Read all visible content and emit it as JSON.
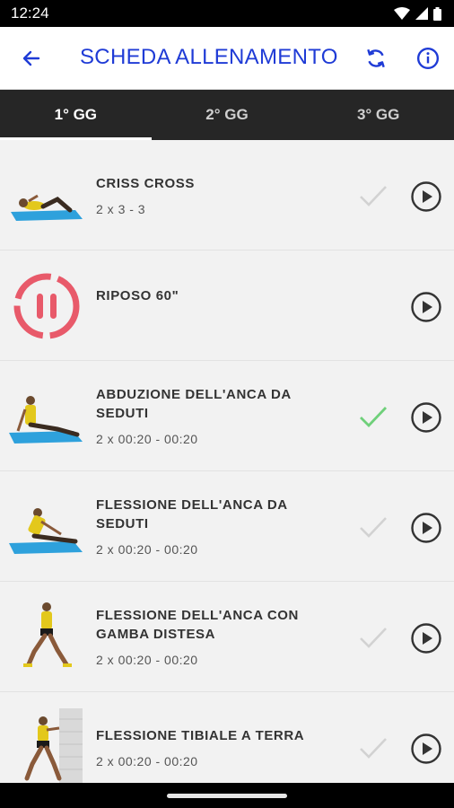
{
  "status": {
    "time": "12:24"
  },
  "header": {
    "title": "SCHEDA ALLENAMENTO",
    "accent": "#1f3bd6"
  },
  "tabs": [
    {
      "label": "1° GG",
      "active": true
    },
    {
      "label": "2° GG",
      "active": false
    },
    {
      "label": "3° GG",
      "active": false
    }
  ],
  "exercises": [
    {
      "name": "CRISS CROSS",
      "detail": "2 x 3 - 3",
      "done": false
    },
    {
      "name": "RIPOSO 60\"",
      "detail": "",
      "done": null
    },
    {
      "name": "ABDUZIONE DELL'ANCA DA SEDUTI",
      "detail": "2 x 00:20 - 00:20",
      "done": true
    },
    {
      "name": "FLESSIONE DELL'ANCA DA SEDUTI",
      "detail": "2 x 00:20 - 00:20",
      "done": false
    },
    {
      "name": "FLESSIONE DELL'ANCA CON GAMBA DISTESA",
      "detail": "2 x 00:20 - 00:20",
      "done": false
    },
    {
      "name": "FLESSIONE TIBIALE A TERRA",
      "detail": "2 x 00:20 - 00:20",
      "done": false
    }
  ],
  "colors": {
    "done_check": "#6fd07a",
    "pending_check": "#cfcfcf",
    "rest_red": "#e85a6a"
  }
}
